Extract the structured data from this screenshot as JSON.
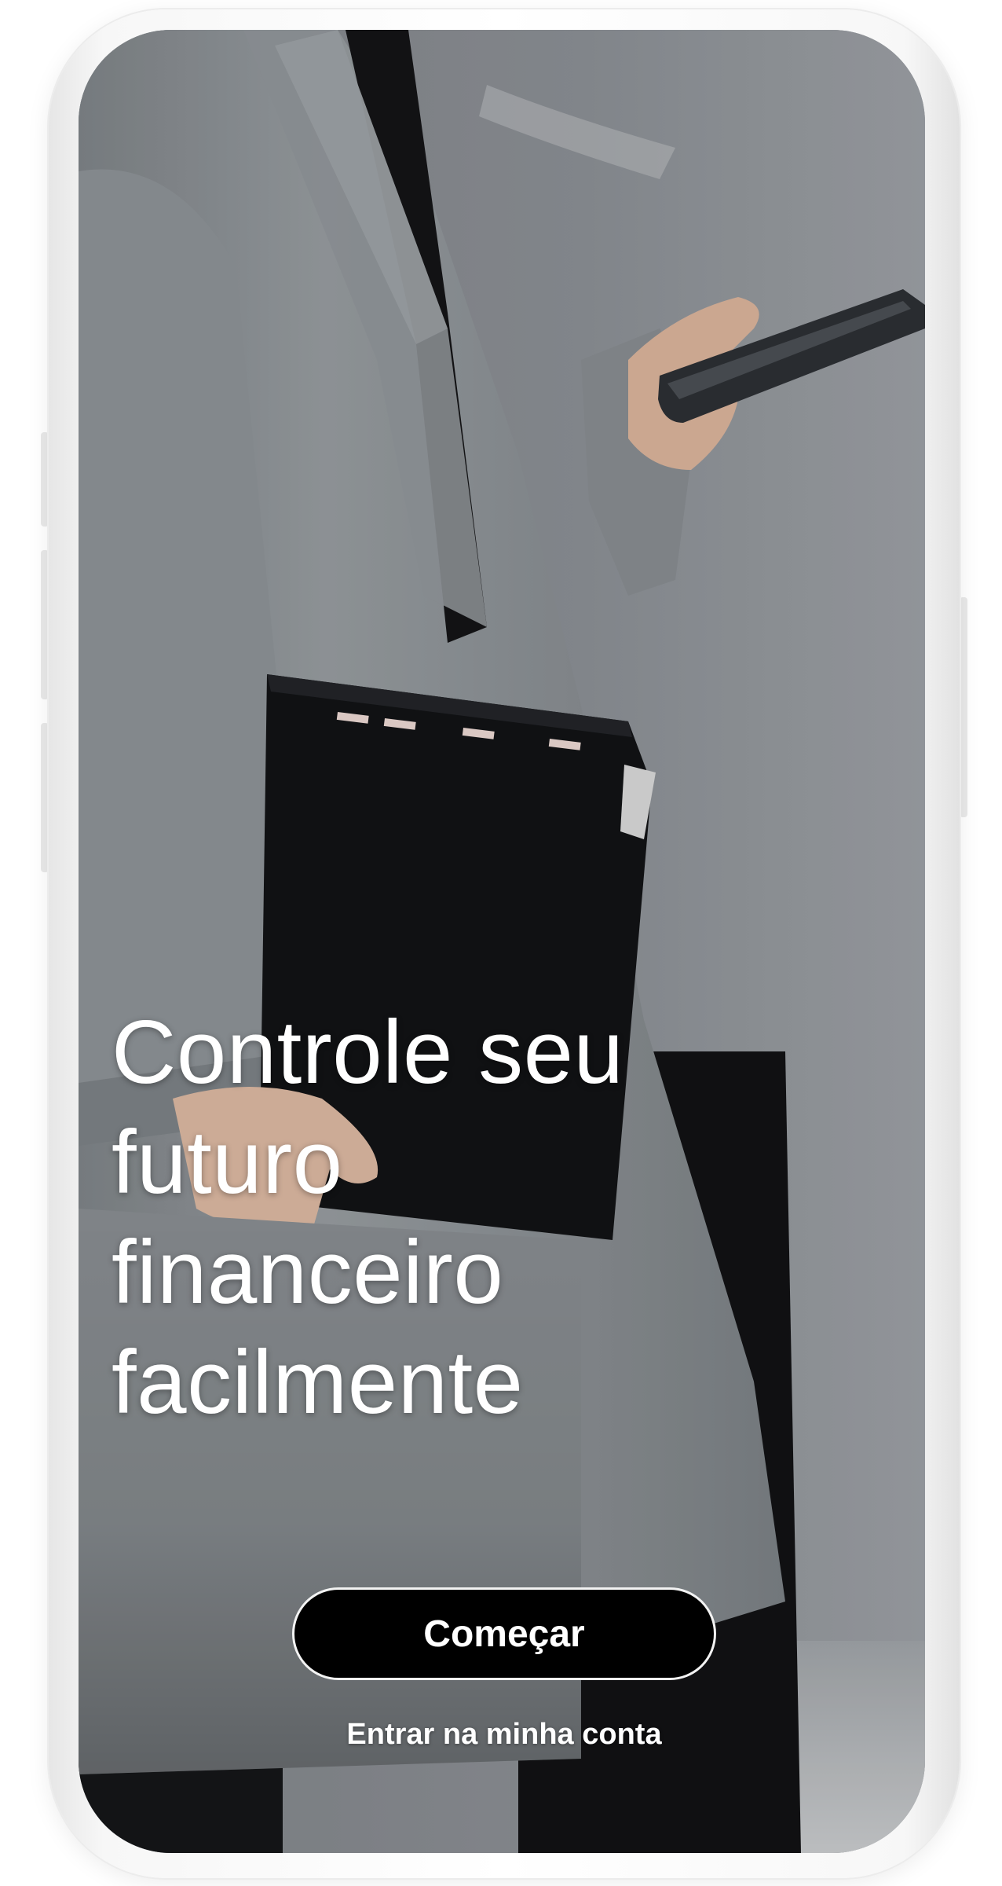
{
  "onboarding": {
    "headline_lines": [
      "Controle seu",
      "futuro",
      "financeiro",
      "facilmente"
    ],
    "primary_button_label": "Começar",
    "secondary_link_label": "Entrar na minha conta"
  },
  "hero_image": {
    "subject": "person in grey coat holding black folder and smartphone"
  },
  "colors": {
    "primary_button_bg": "#000000",
    "primary_button_text": "#ffffff",
    "headline_text": "#ffffff",
    "background_tone": "#8b8f94"
  }
}
